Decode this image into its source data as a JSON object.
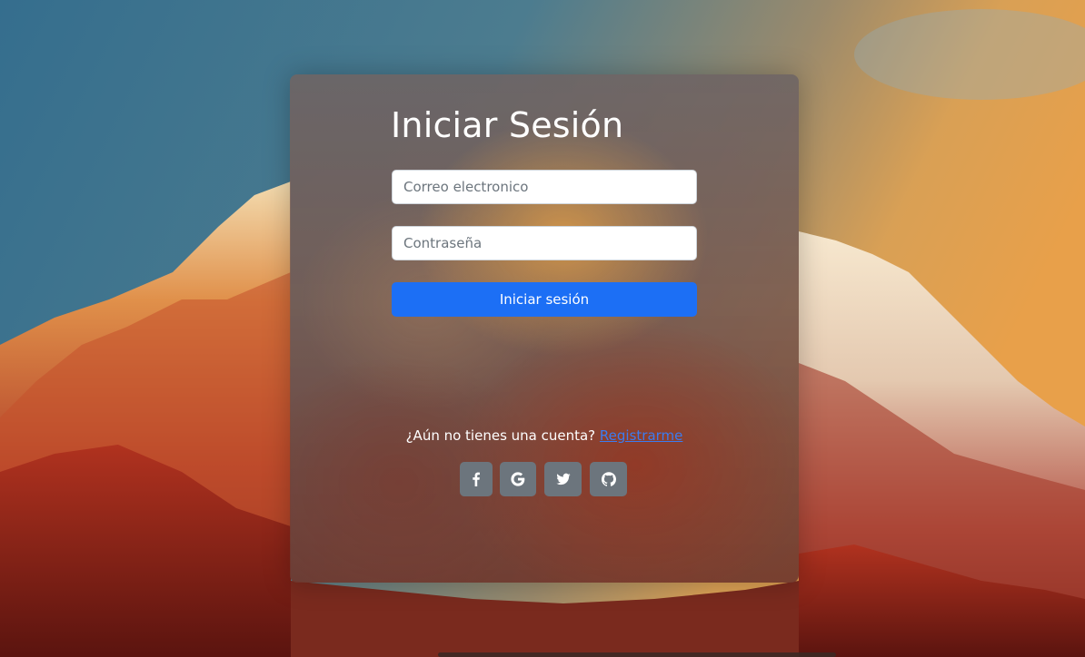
{
  "login": {
    "title": "Iniciar Sesión",
    "email_placeholder": "Correo electronico",
    "password_placeholder": "Contraseña",
    "submit_label": "Iniciar sesión",
    "register_prompt": "¿Aún no tienes una cuenta? ",
    "register_link": "Registrarme"
  },
  "social": [
    {
      "icon": "facebook-icon"
    },
    {
      "icon": "google-icon"
    },
    {
      "icon": "twitter-icon"
    },
    {
      "icon": "github-icon"
    }
  ],
  "colors": {
    "primary": "#1c6ff5",
    "social_button": "#6c757d",
    "link": "#3b7cf0",
    "text": "#ffffff"
  }
}
